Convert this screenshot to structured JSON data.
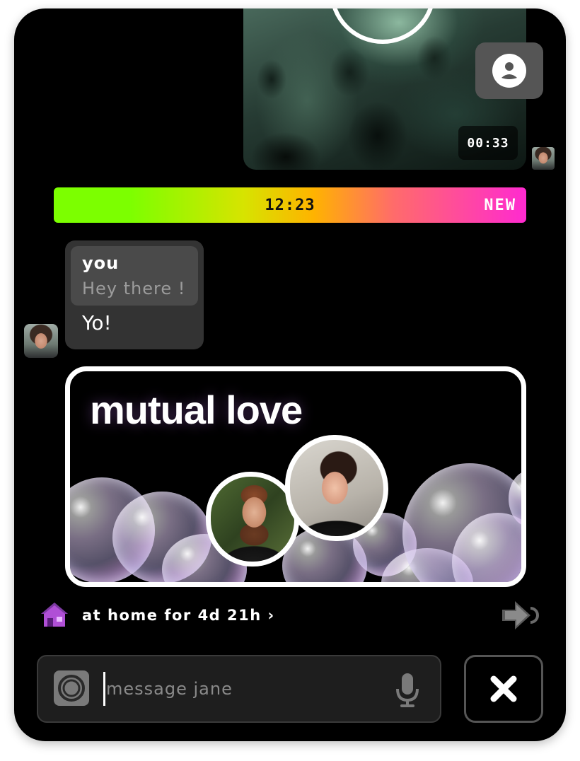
{
  "video_message": {
    "duration": "00:33"
  },
  "divider": {
    "time": "12:23",
    "badge": "NEW"
  },
  "message": {
    "quote_author": "you",
    "quote_text": "Hey there !",
    "reply_text": "Yo!"
  },
  "mutual_card": {
    "title": "mutual love"
  },
  "status": {
    "text": "at home for 4d 21h ›"
  },
  "composer": {
    "placeholder": "message jane"
  },
  "colors": {
    "background": "#000000",
    "divider_gradient": [
      "#7cff00",
      "#d6e400",
      "#ffb300",
      "#ff6b6b",
      "#ff2ad0"
    ],
    "bubble": "#333333",
    "quote_bubble": "#4a4a4a"
  },
  "icons": [
    "person-icon",
    "camera-icon",
    "microphone-icon",
    "close-icon",
    "house-icon",
    "share-forward-icon"
  ]
}
